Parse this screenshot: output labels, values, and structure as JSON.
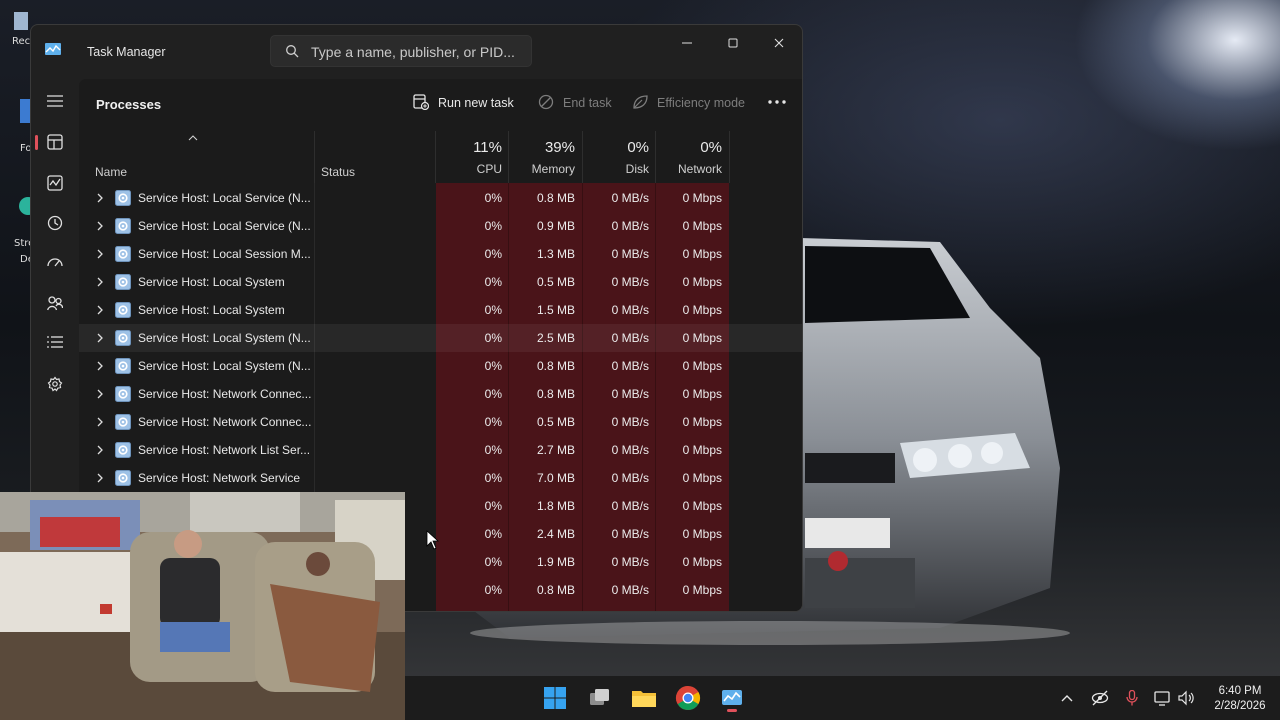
{
  "window": {
    "title": "Task Manager",
    "search_placeholder": "Type a name, publisher, or PID..."
  },
  "page": {
    "title": "Processes"
  },
  "toolbar": {
    "run_new_task": "Run new task",
    "end_task": "End task",
    "efficiency_mode": "Efficiency mode"
  },
  "columns": {
    "name": "Name",
    "status": "Status",
    "cpu": {
      "percent": "11%",
      "label": "CPU"
    },
    "memory": {
      "percent": "39%",
      "label": "Memory"
    },
    "disk": {
      "percent": "0%",
      "label": "Disk"
    },
    "network": {
      "percent": "0%",
      "label": "Network"
    }
  },
  "rows": [
    {
      "name": "Service Host: Local Service (N...",
      "cpu": "0%",
      "memory": "0.8 MB",
      "disk": "0 MB/s",
      "network": "0 Mbps"
    },
    {
      "name": "Service Host: Local Service (N...",
      "cpu": "0%",
      "memory": "0.9 MB",
      "disk": "0 MB/s",
      "network": "0 Mbps"
    },
    {
      "name": "Service Host: Local Session M...",
      "cpu": "0%",
      "memory": "1.3 MB",
      "disk": "0 MB/s",
      "network": "0 Mbps"
    },
    {
      "name": "Service Host: Local System",
      "cpu": "0%",
      "memory": "0.5 MB",
      "disk": "0 MB/s",
      "network": "0 Mbps"
    },
    {
      "name": "Service Host: Local System",
      "cpu": "0%",
      "memory": "1.5 MB",
      "disk": "0 MB/s",
      "network": "0 Mbps"
    },
    {
      "name": "Service Host: Local System (N...",
      "cpu": "0%",
      "memory": "2.5 MB",
      "disk": "0 MB/s",
      "network": "0 Mbps"
    },
    {
      "name": "Service Host: Local System (N...",
      "cpu": "0%",
      "memory": "0.8 MB",
      "disk": "0 MB/s",
      "network": "0 Mbps"
    },
    {
      "name": "Service Host: Network Connec...",
      "cpu": "0%",
      "memory": "0.8 MB",
      "disk": "0 MB/s",
      "network": "0 Mbps"
    },
    {
      "name": "Service Host: Network Connec...",
      "cpu": "0%",
      "memory": "0.5 MB",
      "disk": "0 MB/s",
      "network": "0 Mbps"
    },
    {
      "name": "Service Host: Network List Ser...",
      "cpu": "0%",
      "memory": "2.7 MB",
      "disk": "0 MB/s",
      "network": "0 Mbps"
    },
    {
      "name": "Service Host: Network Service",
      "cpu": "0%",
      "memory": "7.0 MB",
      "disk": "0 MB/s",
      "network": "0 Mbps"
    },
    {
      "name": "",
      "cpu": "0%",
      "memory": "1.8 MB",
      "disk": "0 MB/s",
      "network": "0 Mbps"
    },
    {
      "name": "",
      "cpu": "0%",
      "memory": "2.4 MB",
      "disk": "0 MB/s",
      "network": "0 Mbps"
    },
    {
      "name": "",
      "cpu": "0%",
      "memory": "1.9 MB",
      "disk": "0 MB/s",
      "network": "0 Mbps"
    },
    {
      "name": "",
      "cpu": "0%",
      "memory": "0.8 MB",
      "disk": "0 MB/s",
      "network": "0 Mbps"
    }
  ],
  "nav_icons": [
    "processes-icon",
    "performance-icon",
    "app-history-icon",
    "startup-apps-icon",
    "users-icon",
    "details-icon",
    "services-icon"
  ],
  "taskbar": {
    "apps": [
      "windows-start-icon",
      "task-view-icon",
      "file-explorer-icon",
      "chrome-icon",
      "task-manager-icon"
    ],
    "time": "6:40 PM",
    "date": "2/28/2026"
  },
  "colors": {
    "accent": "#e0515b",
    "metric_highlight": "#4a1419",
    "window_bg": "#202020"
  }
}
